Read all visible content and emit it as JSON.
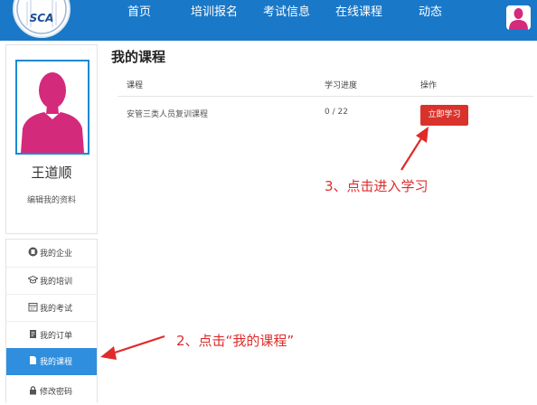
{
  "header": {
    "logo_text": "SCA",
    "nav": [
      "首页",
      "培训报名",
      "考试信息",
      "在线课程",
      "动态"
    ]
  },
  "profile": {
    "name": "王道顺",
    "edit_link": "编辑我的资料"
  },
  "menu": [
    {
      "label": "我的企业",
      "icon": "building-icon"
    },
    {
      "label": "我的培训",
      "icon": "graduation-cap-icon"
    },
    {
      "label": "我的考试",
      "icon": "calendar-icon"
    },
    {
      "label": "我的订单",
      "icon": "order-icon"
    },
    {
      "label": "我的课程",
      "icon": "document-icon"
    },
    {
      "label": "修改密码",
      "icon": "lock-icon"
    }
  ],
  "main": {
    "title": "我的课程",
    "columns": [
      "课程",
      "学习进度",
      "操作"
    ],
    "rows": [
      {
        "course": "安管三类人员复训课程",
        "progress": "0 / 22",
        "action": "立即学习"
      }
    ]
  },
  "annotations": {
    "step3": "3、点击进入学习",
    "step2": "2、点击“我的课程”"
  },
  "colors": {
    "header": "#1a78c8",
    "active_menu": "#2f8fde",
    "button": "#d9322b",
    "annotation": "#e02b2b",
    "avatar": "#d42a7c"
  }
}
